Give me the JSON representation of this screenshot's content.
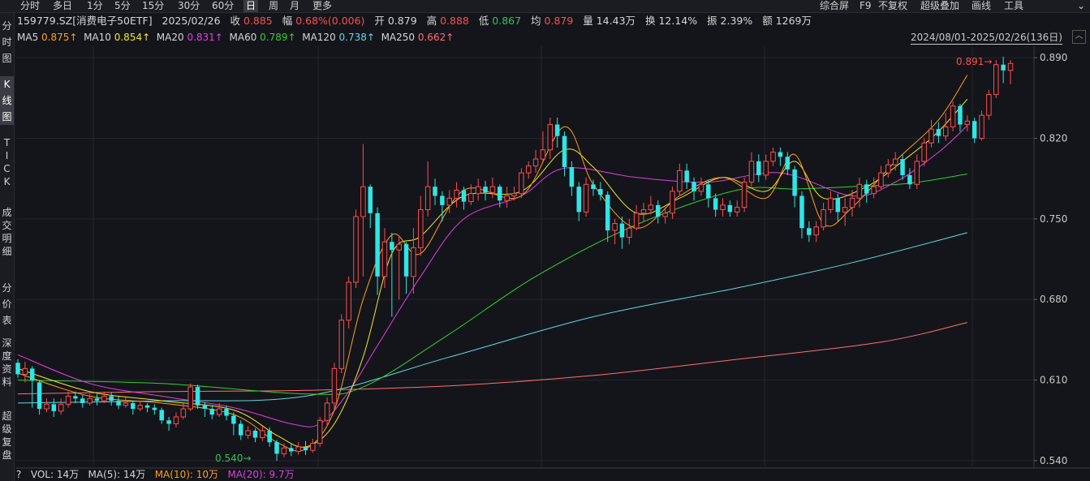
{
  "toolbar": {
    "periods": [
      "分时",
      "多日",
      "1分",
      "5分",
      "15分",
      "30分",
      "60分",
      "日",
      "周",
      "月",
      "更多"
    ],
    "active_period": "日",
    "right_items": [
      "综合屏",
      "F9",
      "不复权",
      "超级叠加",
      "画线",
      "工具"
    ]
  },
  "sidebar": [
    "分\n时\n图",
    "K\n线\n图",
    "T\nI\nC\nK",
    "成\n交\n明\n细",
    "分\n价\n表",
    "深\n度\n资\n料",
    "超\n级\n复\n盘"
  ],
  "quote": {
    "code_name": "159779.SZ[消费电子50ETF]",
    "date": "2025/02/26",
    "close_label": "收",
    "close": "0.885",
    "change_label": "幅",
    "change": "0.68%(0.006)",
    "open_label": "开",
    "open": "0.879",
    "high_label": "高",
    "high": "0.888",
    "low_label": "低",
    "low": "0.867",
    "avg_label": "均",
    "avg": "0.879",
    "volume_label": "量",
    "volume": "14.43万",
    "turnover_label": "换",
    "turnover": "12.14%",
    "amplitude_label": "振",
    "amplitude": "2.39%",
    "amount_label": "额",
    "amount": "1269万"
  },
  "ma_legend": [
    {
      "label": "MA5",
      "value": "0.875↑",
      "color": "#ff9f1a"
    },
    {
      "label": "MA10",
      "value": "0.854↑",
      "color": "#f5e52a"
    },
    {
      "label": "MA20",
      "value": "0.831↑",
      "color": "#e23de2"
    },
    {
      "label": "MA60",
      "value": "0.789↑",
      "color": "#2fd02f"
    },
    {
      "label": "MA120",
      "value": "0.738↑",
      "color": "#5fd9e6"
    },
    {
      "label": "MA250",
      "value": "0.662↑",
      "color": "#ff6f6f"
    }
  ],
  "date_range": "2024/08/01-2025/02/26(136日)",
  "volume_bar": {
    "q": "?",
    "vol": "VOL: 14万",
    "ma5": "MA(5): 14万",
    "ma10": "MA(10): 10万",
    "ma20": "MA(20): 9.7万"
  },
  "colors": {
    "up": "#ff4d4f",
    "down": "#2ee6e6",
    "bg": "#14151a",
    "grid": "#2a2b31"
  },
  "chart_data": {
    "type": "candlestick",
    "y_ticks": [
      "0.890",
      "0.820",
      "0.750",
      "0.680",
      "0.610",
      "0.540"
    ],
    "ylim": [
      0.535,
      0.9
    ],
    "high_marker": "0.891",
    "low_marker": "0.540",
    "candles": [
      [
        0.625,
        0.615,
        0.628,
        0.612
      ],
      [
        0.615,
        0.62,
        0.626,
        0.608
      ],
      [
        0.62,
        0.61,
        0.622,
        0.586
      ],
      [
        0.608,
        0.585,
        0.61,
        0.58
      ],
      [
        0.585,
        0.589,
        0.594,
        0.582
      ],
      [
        0.589,
        0.583,
        0.594,
        0.578
      ],
      [
        0.583,
        0.589,
        0.594,
        0.58
      ],
      [
        0.589,
        0.596,
        0.6,
        0.586
      ],
      [
        0.596,
        0.594,
        0.6,
        0.59
      ],
      [
        0.594,
        0.59,
        0.597,
        0.586
      ],
      [
        0.59,
        0.594,
        0.598,
        0.588
      ],
      [
        0.594,
        0.592,
        0.598,
        0.588
      ],
      [
        0.592,
        0.596,
        0.6,
        0.59
      ],
      [
        0.596,
        0.592,
        0.599,
        0.588
      ],
      [
        0.592,
        0.588,
        0.596,
        0.585
      ],
      [
        0.588,
        0.59,
        0.595,
        0.586
      ],
      [
        0.59,
        0.585,
        0.592,
        0.58
      ],
      [
        0.585,
        0.588,
        0.592,
        0.583
      ],
      [
        0.588,
        0.586,
        0.59,
        0.582
      ],
      [
        0.586,
        0.584,
        0.589,
        0.58
      ],
      [
        0.584,
        0.575,
        0.586,
        0.572
      ],
      [
        0.575,
        0.572,
        0.578,
        0.566
      ],
      [
        0.572,
        0.578,
        0.582,
        0.569
      ],
      [
        0.578,
        0.585,
        0.59,
        0.576
      ],
      [
        0.585,
        0.604,
        0.607,
        0.583
      ],
      [
        0.604,
        0.588,
        0.606,
        0.585
      ],
      [
        0.588,
        0.585,
        0.591,
        0.578
      ],
      [
        0.585,
        0.58,
        0.588,
        0.576
      ],
      [
        0.58,
        0.585,
        0.59,
        0.578
      ],
      [
        0.585,
        0.579,
        0.588,
        0.575
      ],
      [
        0.579,
        0.572,
        0.582,
        0.562
      ],
      [
        0.572,
        0.562,
        0.575,
        0.558
      ],
      [
        0.562,
        0.566,
        0.57,
        0.559
      ],
      [
        0.566,
        0.56,
        0.568,
        0.556
      ],
      [
        0.56,
        0.566,
        0.57,
        0.557
      ],
      [
        0.566,
        0.556,
        0.569,
        0.552
      ],
      [
        0.556,
        0.546,
        0.558,
        0.54
      ],
      [
        0.546,
        0.551,
        0.555,
        0.543
      ],
      [
        0.551,
        0.548,
        0.555,
        0.544
      ],
      [
        0.548,
        0.552,
        0.556,
        0.545
      ],
      [
        0.552,
        0.549,
        0.557,
        0.545
      ],
      [
        0.549,
        0.555,
        0.559,
        0.547
      ],
      [
        0.555,
        0.575,
        0.578,
        0.552
      ],
      [
        0.575,
        0.59,
        0.595,
        0.57
      ],
      [
        0.59,
        0.62,
        0.625,
        0.585
      ],
      [
        0.62,
        0.662,
        0.667,
        0.616
      ],
      [
        0.662,
        0.695,
        0.7,
        0.655
      ],
      [
        0.695,
        0.752,
        0.758,
        0.69
      ],
      [
        0.752,
        0.778,
        0.815,
        0.7
      ],
      [
        0.778,
        0.755,
        0.78,
        0.742
      ],
      [
        0.755,
        0.7,
        0.76,
        0.684
      ],
      [
        0.7,
        0.73,
        0.742,
        0.69
      ],
      [
        0.73,
        0.723,
        0.738,
        0.665
      ],
      [
        0.723,
        0.728,
        0.735,
        0.68
      ],
      [
        0.728,
        0.7,
        0.73,
        0.685
      ],
      [
        0.7,
        0.725,
        0.742,
        0.685
      ],
      [
        0.725,
        0.758,
        0.77,
        0.718
      ],
      [
        0.758,
        0.778,
        0.8,
        0.752
      ],
      [
        0.778,
        0.77,
        0.785,
        0.762
      ],
      [
        0.77,
        0.762,
        0.774,
        0.748
      ],
      [
        0.762,
        0.768,
        0.775,
        0.755
      ],
      [
        0.768,
        0.775,
        0.782,
        0.76
      ],
      [
        0.775,
        0.765,
        0.778,
        0.758
      ],
      [
        0.765,
        0.772,
        0.78,
        0.762
      ],
      [
        0.772,
        0.778,
        0.785,
        0.766
      ],
      [
        0.778,
        0.773,
        0.783,
        0.766
      ],
      [
        0.773,
        0.778,
        0.786,
        0.768
      ],
      [
        0.778,
        0.766,
        0.78,
        0.76
      ],
      [
        0.766,
        0.77,
        0.778,
        0.76
      ],
      [
        0.77,
        0.772,
        0.778,
        0.766
      ],
      [
        0.772,
        0.79,
        0.794,
        0.768
      ],
      [
        0.79,
        0.796,
        0.8,
        0.785
      ],
      [
        0.796,
        0.802,
        0.81,
        0.79
      ],
      [
        0.802,
        0.81,
        0.826,
        0.8
      ],
      [
        0.81,
        0.832,
        0.838,
        0.802
      ],
      [
        0.832,
        0.822,
        0.838,
        0.812
      ],
      [
        0.822,
        0.795,
        0.826,
        0.787
      ],
      [
        0.795,
        0.778,
        0.8,
        0.77
      ],
      [
        0.778,
        0.756,
        0.782,
        0.748
      ],
      [
        0.756,
        0.78,
        0.786,
        0.752
      ],
      [
        0.78,
        0.776,
        0.784,
        0.77
      ],
      [
        0.776,
        0.771,
        0.782,
        0.766
      ],
      [
        0.771,
        0.74,
        0.774,
        0.73
      ],
      [
        0.74,
        0.746,
        0.75,
        0.728
      ],
      [
        0.746,
        0.734,
        0.752,
        0.724
      ],
      [
        0.734,
        0.742,
        0.75,
        0.728
      ],
      [
        0.742,
        0.755,
        0.762,
        0.74
      ],
      [
        0.755,
        0.758,
        0.764,
        0.748
      ],
      [
        0.758,
        0.762,
        0.77,
        0.754
      ],
      [
        0.762,
        0.752,
        0.766,
        0.746
      ],
      [
        0.752,
        0.755,
        0.76,
        0.746
      ],
      [
        0.755,
        0.774,
        0.778,
        0.75
      ],
      [
        0.774,
        0.792,
        0.798,
        0.77
      ],
      [
        0.792,
        0.782,
        0.798,
        0.776
      ],
      [
        0.782,
        0.774,
        0.786,
        0.766
      ],
      [
        0.774,
        0.78,
        0.786,
        0.77
      ],
      [
        0.78,
        0.768,
        0.784,
        0.76
      ],
      [
        0.768,
        0.758,
        0.772,
        0.752
      ],
      [
        0.758,
        0.762,
        0.768,
        0.752
      ],
      [
        0.762,
        0.756,
        0.766,
        0.752
      ],
      [
        0.756,
        0.76,
        0.766,
        0.752
      ],
      [
        0.76,
        0.782,
        0.786,
        0.756
      ],
      [
        0.782,
        0.8,
        0.808,
        0.778
      ],
      [
        0.8,
        0.788,
        0.806,
        0.782
      ],
      [
        0.788,
        0.8,
        0.806,
        0.784
      ],
      [
        0.8,
        0.808,
        0.812,
        0.796
      ],
      [
        0.808,
        0.804,
        0.812,
        0.796
      ],
      [
        0.804,
        0.793,
        0.808,
        0.788
      ],
      [
        0.793,
        0.77,
        0.796,
        0.76
      ],
      [
        0.77,
        0.742,
        0.774,
        0.733
      ],
      [
        0.742,
        0.736,
        0.748,
        0.73
      ],
      [
        0.736,
        0.743,
        0.748,
        0.73
      ],
      [
        0.743,
        0.758,
        0.764,
        0.74
      ],
      [
        0.758,
        0.768,
        0.774,
        0.755
      ],
      [
        0.768,
        0.756,
        0.772,
        0.748
      ],
      [
        0.756,
        0.76,
        0.768,
        0.744
      ],
      [
        0.76,
        0.768,
        0.775,
        0.752
      ],
      [
        0.768,
        0.78,
        0.786,
        0.76
      ],
      [
        0.78,
        0.772,
        0.784,
        0.764
      ],
      [
        0.772,
        0.778,
        0.786,
        0.768
      ],
      [
        0.778,
        0.79,
        0.796,
        0.776
      ],
      [
        0.79,
        0.797,
        0.802,
        0.786
      ],
      [
        0.797,
        0.802,
        0.808,
        0.792
      ],
      [
        0.802,
        0.788,
        0.806,
        0.784
      ],
      [
        0.788,
        0.78,
        0.794,
        0.776
      ],
      [
        0.78,
        0.8,
        0.806,
        0.776
      ],
      [
        0.8,
        0.816,
        0.82,
        0.796
      ],
      [
        0.816,
        0.828,
        0.836,
        0.812
      ],
      [
        0.828,
        0.822,
        0.834,
        0.816
      ],
      [
        0.822,
        0.83,
        0.842,
        0.818
      ],
      [
        0.83,
        0.848,
        0.852,
        0.826
      ],
      [
        0.848,
        0.832,
        0.85,
        0.826
      ],
      [
        0.832,
        0.835,
        0.84,
        0.826
      ],
      [
        0.835,
        0.82,
        0.838,
        0.816
      ],
      [
        0.82,
        0.84,
        0.844,
        0.818
      ],
      [
        0.84,
        0.858,
        0.862,
        0.836
      ],
      [
        0.858,
        0.884,
        0.888,
        0.855
      ],
      [
        0.884,
        0.879,
        0.891,
        0.868
      ],
      [
        0.879,
        0.885,
        0.888,
        0.867
      ]
    ],
    "ma_series": {
      "MA250": [
        [
          0,
          0.598
        ],
        [
          20,
          0.6
        ],
        [
          40,
          0.601
        ],
        [
          60,
          0.605
        ],
        [
          80,
          0.614
        ],
        [
          100,
          0.628
        ],
        [
          120,
          0.643
        ],
        [
          132,
          0.66
        ]
      ],
      "MA120": [
        [
          0,
          0.59
        ],
        [
          20,
          0.592
        ],
        [
          40,
          0.596
        ],
        [
          60,
          0.63
        ],
        [
          80,
          0.665
        ],
        [
          100,
          0.69
        ],
        [
          116,
          0.712
        ],
        [
          132,
          0.738
        ]
      ],
      "MA60": [
        [
          0,
          0.61
        ],
        [
          20,
          0.607
        ],
        [
          40,
          0.598
        ],
        [
          48,
          0.604
        ],
        [
          60,
          0.65
        ],
        [
          72,
          0.7
        ],
        [
          86,
          0.745
        ],
        [
          100,
          0.775
        ],
        [
          108,
          0.776
        ],
        [
          116,
          0.778
        ],
        [
          124,
          0.781
        ],
        [
          132,
          0.789
        ]
      ],
      "MA20": [
        [
          0,
          0.632
        ],
        [
          10,
          0.607
        ],
        [
          20,
          0.596
        ],
        [
          30,
          0.586
        ],
        [
          38,
          0.572
        ],
        [
          42,
          0.572
        ],
        [
          46,
          0.6
        ],
        [
          50,
          0.64
        ],
        [
          56,
          0.7
        ],
        [
          62,
          0.75
        ],
        [
          70,
          0.77
        ],
        [
          76,
          0.794
        ],
        [
          86,
          0.786
        ],
        [
          96,
          0.782
        ],
        [
          106,
          0.79
        ],
        [
          116,
          0.77
        ],
        [
          122,
          0.782
        ],
        [
          128,
          0.808
        ],
        [
          132,
          0.831
        ]
      ],
      "MA10": [
        [
          0,
          0.62
        ],
        [
          10,
          0.6
        ],
        [
          20,
          0.592
        ],
        [
          30,
          0.584
        ],
        [
          36,
          0.562
        ],
        [
          40,
          0.552
        ],
        [
          44,
          0.572
        ],
        [
          48,
          0.63
        ],
        [
          52,
          0.72
        ],
        [
          56,
          0.735
        ],
        [
          62,
          0.77
        ],
        [
          70,
          0.774
        ],
        [
          76,
          0.81
        ],
        [
          80,
          0.795
        ],
        [
          86,
          0.755
        ],
        [
          92,
          0.768
        ],
        [
          98,
          0.786
        ],
        [
          104,
          0.774
        ],
        [
          108,
          0.8
        ],
        [
          112,
          0.768
        ],
        [
          118,
          0.778
        ],
        [
          124,
          0.805
        ],
        [
          128,
          0.826
        ],
        [
          132,
          0.854
        ]
      ],
      "MA5": [
        [
          0,
          0.616
        ],
        [
          10,
          0.596
        ],
        [
          20,
          0.59
        ],
        [
          30,
          0.58
        ],
        [
          36,
          0.556
        ],
        [
          40,
          0.55
        ],
        [
          44,
          0.584
        ],
        [
          48,
          0.68
        ],
        [
          52,
          0.736
        ],
        [
          56,
          0.72
        ],
        [
          62,
          0.775
        ],
        [
          70,
          0.77
        ],
        [
          76,
          0.83
        ],
        [
          80,
          0.78
        ],
        [
          86,
          0.742
        ],
        [
          92,
          0.77
        ],
        [
          98,
          0.786
        ],
        [
          104,
          0.768
        ],
        [
          108,
          0.806
        ],
        [
          112,
          0.746
        ],
        [
          116,
          0.76
        ],
        [
          122,
          0.8
        ],
        [
          128,
          0.836
        ],
        [
          132,
          0.875
        ]
      ]
    }
  }
}
